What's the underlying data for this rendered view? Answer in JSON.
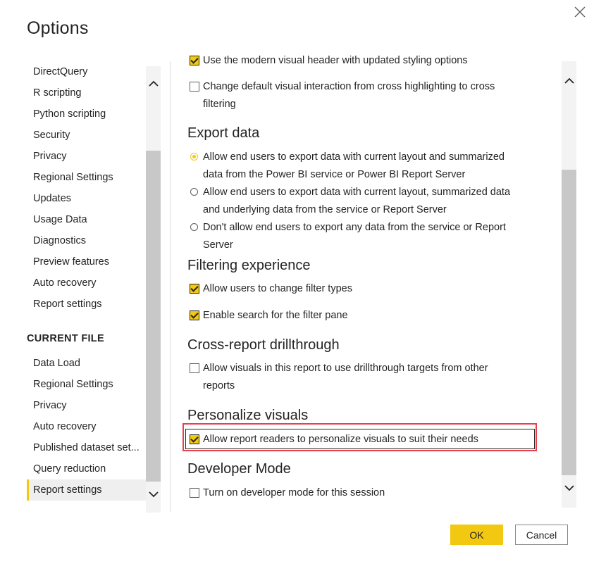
{
  "dialog": {
    "title": "Options",
    "close_icon": "close-icon"
  },
  "nav": {
    "global_items": [
      "DirectQuery",
      "R scripting",
      "Python scripting",
      "Security",
      "Privacy",
      "Regional Settings",
      "Updates",
      "Usage Data",
      "Diagnostics",
      "Preview features",
      "Auto recovery",
      "Report settings"
    ],
    "current_file_heading": "CURRENT FILE",
    "current_file_items": [
      "Data Load",
      "Regional Settings",
      "Privacy",
      "Auto recovery",
      "Published dataset set...",
      "Query reduction",
      "Report settings"
    ],
    "selected": "Report settings"
  },
  "content": {
    "top_options": [
      {
        "label": "Use the modern visual header with updated styling options",
        "checked": true
      },
      {
        "label": "Change default visual interaction from cross highlighting to cross filtering",
        "checked": false
      }
    ],
    "export_data": {
      "title": "Export data",
      "options": [
        {
          "label": "Allow end users to export data with current layout and summarized data from the Power BI service or Power BI Report Server",
          "selected": true
        },
        {
          "label": "Allow end users to export data with current layout, summarized data and underlying data from the service or Report Server",
          "selected": false
        },
        {
          "label": "Don't allow end users to export any data from the service or Report Server",
          "selected": false
        }
      ]
    },
    "filtering": {
      "title": "Filtering experience",
      "options": [
        {
          "label": "Allow users to change filter types",
          "checked": true
        },
        {
          "label": "Enable search for the filter pane",
          "checked": true
        }
      ]
    },
    "drillthrough": {
      "title": "Cross-report drillthrough",
      "options": [
        {
          "label": "Allow visuals in this report to use drillthrough targets from other reports",
          "checked": false
        }
      ]
    },
    "personalize": {
      "title": "Personalize visuals",
      "options": [
        {
          "label": "Allow report readers to personalize visuals to suit their needs",
          "checked": true
        }
      ]
    },
    "developer": {
      "title": "Developer Mode",
      "options": [
        {
          "label": "Turn on developer mode for this session",
          "checked": false
        }
      ]
    }
  },
  "buttons": {
    "ok_label": "OK",
    "cancel_label": "Cancel"
  },
  "colors": {
    "accent": "#f2c811",
    "highlight_box": "#e8414d",
    "scroll_track": "#f3f3f3",
    "scroll_thumb": "#c8c8c8"
  }
}
